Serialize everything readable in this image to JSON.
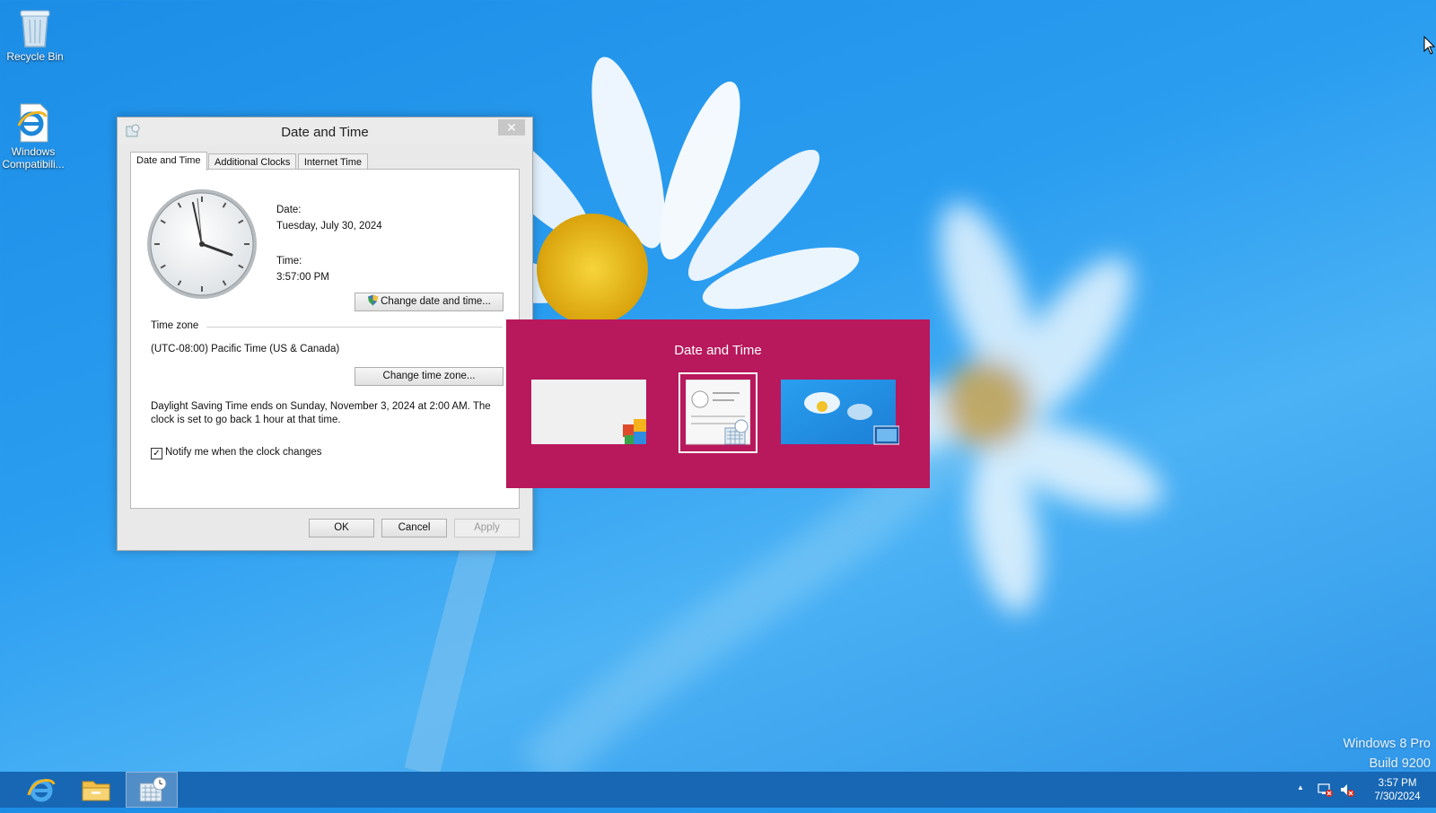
{
  "desktop": {
    "icons": [
      {
        "label": "Recycle Bin"
      },
      {
        "label": "Windows Compatibili..."
      }
    ],
    "watermark": {
      "line1": "Windows 8 Pro",
      "line2": "Build 9200"
    }
  },
  "dialog": {
    "title": "Date and Time",
    "close_symbol": "✕",
    "tabs": [
      {
        "label": "Date and Time",
        "active": true
      },
      {
        "label": "Additional Clocks",
        "active": false
      },
      {
        "label": "Internet Time",
        "active": false
      }
    ],
    "date_label": "Date:",
    "date_value": "Tuesday, July 30, 2024",
    "time_label": "Time:",
    "time_value": "3:57:00 PM",
    "change_datetime_button": "Change date and time...",
    "timezone_header": "Time zone",
    "timezone_value": "(UTC-08:00) Pacific Time (US & Canada)",
    "change_timezone_button": "Change time zone...",
    "dst_line1": "Daylight Saving Time ends on Sunday, November 3, 2024 at 2:00 AM. The",
    "dst_line2": "clock is set to go back 1 hour at that time.",
    "notify_checkbox_label": "Notify me when the clock changes",
    "notify_checked": true,
    "ok_button": "OK",
    "cancel_button": "Cancel",
    "apply_button": "Apply"
  },
  "switcher": {
    "title": "Date and Time",
    "thumbnails": [
      {
        "name": "control-panel-window",
        "selected": false
      },
      {
        "name": "date-and-time-window",
        "selected": true
      },
      {
        "name": "desktop",
        "selected": false
      }
    ],
    "accent": "#b8185c"
  },
  "taskbar": {
    "clock_time": "3:57 PM",
    "clock_date": "7/30/2024",
    "tray_up_arrow": "▲",
    "color": "#1767b4"
  }
}
